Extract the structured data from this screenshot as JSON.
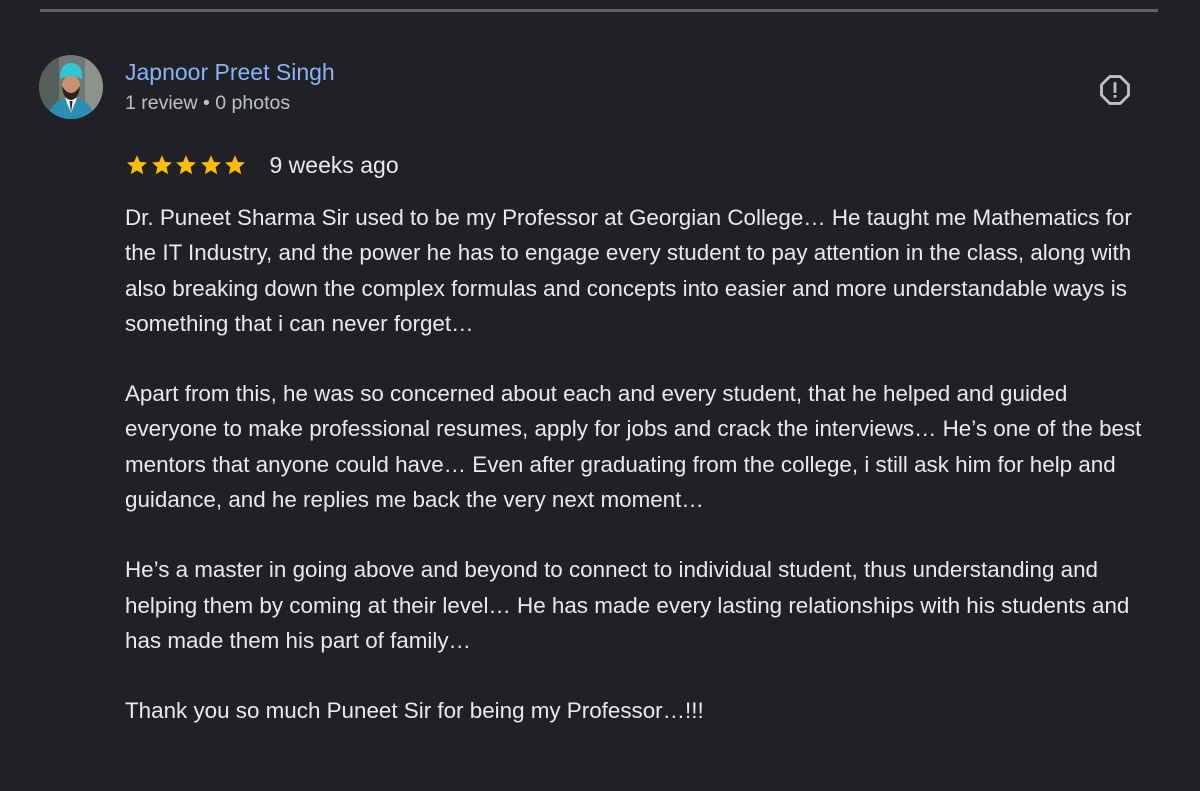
{
  "reviewer": {
    "name": "Japnoor Preet Singh",
    "meta": "1 review • 0 photos"
  },
  "review": {
    "rating": 5,
    "max_rating": 5,
    "date": "9 weeks ago",
    "paragraphs": [
      "Dr. Puneet Sharma Sir used to be my Professor at Georgian College… He taught me Mathematics for the IT Industry, and the power he has to engage every student to pay attention in the class, along with also breaking down the complex formulas and concepts into easier and more understandable ways is something that i can never forget…",
      "Apart from this, he was so concerned about each and every student, that he helped and guided everyone to make professional resumes, apply for jobs and crack the interviews… He’s one of the best mentors that anyone could have… Even after graduating from the college, i still ask him for help and guidance, and he replies me back the very next moment…",
      "He’s a master in going above and beyond to connect to individual student, thus understanding and helping them by coming at their level… He has made every lasting relationships with his students and has made them his part of family…",
      "Thank you so much Puneet Sir for being my Professor…!!!"
    ]
  },
  "icons": {
    "report": "report-flag-icon",
    "star": "star-icon"
  },
  "colors": {
    "background": "#202124",
    "name_link": "#8ab4f8",
    "star": "#fbbc04",
    "text": "#e8eaed",
    "secondary_text": "#bdc1c6"
  }
}
